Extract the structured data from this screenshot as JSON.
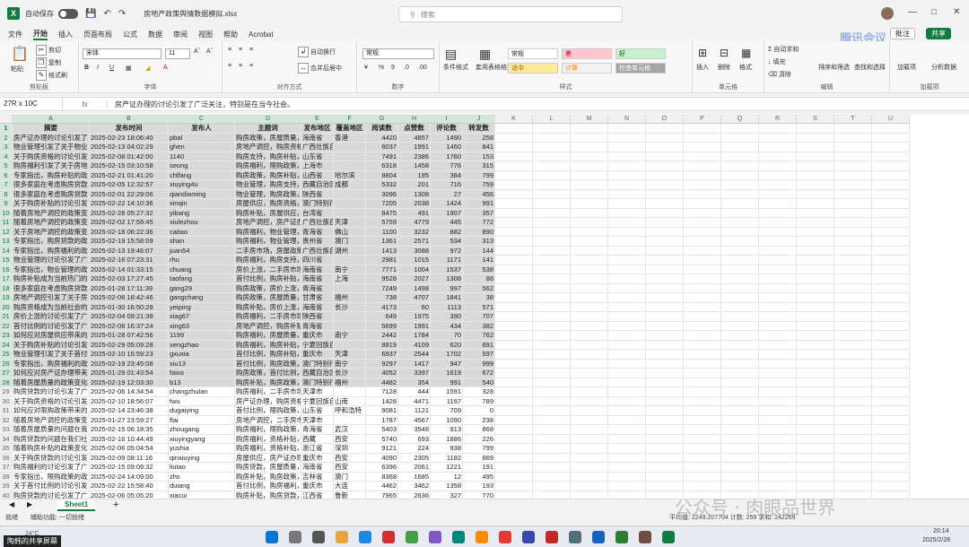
{
  "titlebar": {
    "autosave_label": "自动保存",
    "toggle_state": "关",
    "doc_title": "房地产政策舆情数据模拟.xlsx",
    "search_placeholder": "搜索"
  },
  "menu": {
    "items": [
      "文件",
      "开始",
      "插入",
      "页面布局",
      "公式",
      "数据",
      "审阅",
      "视图",
      "帮助",
      "Acrobat"
    ],
    "active": "开始",
    "comment_label": "批注",
    "share_label": "共享"
  },
  "ribbon": {
    "clipboard_label": "剪贴板",
    "cut": "剪切",
    "copy": "复制",
    "format_painter": "格式刷",
    "paste": "粘贴",
    "font_label": "字体",
    "font_name": "宋体",
    "font_size": "11",
    "align_label": "对齐方式",
    "wrap_text": "自动换行",
    "merge_center": "合并后居中",
    "number_label": "数字",
    "number_format": "常规",
    "styles_label": "样式",
    "cond_format": "条件格式",
    "table_format": "套用表格格式",
    "style_cells": [
      "常规",
      "差",
      "好",
      "适中",
      "计算",
      "检查单元格"
    ],
    "cells_label": "单元格",
    "insert": "插入",
    "delete": "删除",
    "format": "格式",
    "editing_label": "编辑",
    "autosum": "自动求和",
    "fill": "填充",
    "clear": "清除",
    "sort_filter": "排序和筛选",
    "find_select": "查找和选择",
    "addins_label": "加载项",
    "addins": "加载项",
    "analyze": "分析数据"
  },
  "formula_bar": {
    "name_box": "27R x 10C",
    "fx": "fx",
    "formula": "房产证办理的讨论引发了广泛关注，特别是在当今社会。"
  },
  "columns": [
    "A",
    "B",
    "C",
    "D",
    "E",
    "F",
    "G",
    "H",
    "I",
    "J",
    "K",
    "L",
    "M",
    "N",
    "O",
    "P",
    "Q",
    "R",
    "S",
    "T",
    "U"
  ],
  "headers": [
    "摘要",
    "发布时间",
    "发布人",
    "主题词",
    "发布地区",
    "覆盖地区",
    "阅读数",
    "点赞数",
    "评论数",
    "转发数"
  ],
  "rows": [
    [
      "房产证办理的讨论引发了",
      "2025-02-23 18:06:40",
      "pbal",
      "购房政策，房屋质量，",
      "海南省",
      "香港",
      "4420",
      "4857",
      "1490",
      "258"
    ],
    [
      "物业管理引发了关于物业",
      "2025-02-13 04:02:29",
      "ghen",
      "房地产调控，购房资格",
      "广西壮族自治区",
      "",
      "6037",
      "1991",
      "1460",
      "841"
    ],
    [
      "关于购房资格的讨论引发",
      "2025-02-08 01:42:00",
      "1140",
      "购房支持，购房补贴，",
      "山东省",
      "",
      "7491",
      "2386",
      "1760",
      "153"
    ],
    [
      "购房福利引发了关于房地",
      "2025-02-15 03:10:58",
      "seong",
      "购房福利，限购政策，",
      "上海市",
      "",
      "6318",
      "1458",
      "776",
      "315"
    ],
    [
      "专家指出，购房补贴的政",
      "2025-02-21 01:41:20",
      "chlfang",
      "购房政策，购房补贴，",
      "山西省",
      "哈尔滨",
      "8804",
      "195",
      "384",
      "799"
    ],
    [
      "很多家庭在考虑购房贷款",
      "2025-02-05 12:32:57",
      "xiuying4u",
      "物业管理，购房支持，",
      "西藏自治区",
      "成都",
      "5332",
      "201",
      "716",
      "759"
    ],
    [
      "很多家庭在考虑购房贷款",
      "2025-02-01 22:29:06",
      "qiandiaming",
      "物业管理，购房政策，",
      "陕西省",
      "",
      "3096",
      "1308",
      "27",
      "456"
    ],
    [
      "关于购房补贴的讨论引发",
      "2025-02-22 14:10:36",
      "xinqin",
      "房屋供应，购房资格，",
      "澳门特别行政区",
      "",
      "7205",
      "2038",
      "1424",
      "991"
    ],
    [
      "随着房地产调控的政策变",
      "2025-02-28 05:27:32",
      "yibang",
      "购房补贴，房屋供应，",
      "台湾省",
      "",
      "8475",
      "491",
      "1907",
      "357"
    ],
    [
      "随着房地产调控的政策变",
      "2025-02-02 17:59:45",
      "xiulezhou",
      "房地产调控，房产证办",
      "广西壮族自治区",
      "天津",
      "5759",
      "4779",
      "445",
      "772"
    ],
    [
      "关于房地产调控的政策变",
      "2025-02-18 06:22:36",
      "caitao",
      "购房福利，物业管理，",
      "青海省",
      "佛山",
      "1100",
      "3232",
      "882",
      "890"
    ],
    [
      "专家指出，购房贷款的政",
      "2025-02-19 15:58:09",
      "shan",
      "购房福利，物业管理，",
      "贵州省",
      "澳门",
      "1361",
      "2571",
      "534",
      "313"
    ],
    [
      "专家指出，购房福利的政",
      "2025-02-13 19:46:07",
      "juan54",
      "二手房市场，房屋政策，",
      "广西壮族自治区",
      "湖州",
      "1413",
      "3088",
      "972",
      "144"
    ],
    [
      "物业管理的讨论引发了广",
      "2025-02-16 07:23:31",
      "rhu",
      "购房福利，购房支持，",
      "四川省",
      "",
      "2981",
      "1015",
      "1171",
      "141"
    ],
    [
      "专家指出，物业管理的政",
      "2025-02-14 01:33:15",
      "chuang",
      "房价上涨，二手房市场",
      "海南省",
      "南宁",
      "7771",
      "1004",
      "1537",
      "538"
    ],
    [
      "购房补贴成为当前热门的",
      "2025-02-03 17:27:45",
      "taofang",
      "首付比例，购房补贴，",
      "海南省",
      "上海",
      "9528",
      "2027",
      "1308",
      "88"
    ],
    [
      "很多家庭在考虑购房贷款",
      "2025-01-28 17:11:39",
      "gang29",
      "购房政策，房价上涨，",
      "青海省",
      "",
      "7249",
      "1498",
      "997",
      "562"
    ],
    [
      "房地产调控引发了关于房",
      "2025-02-06 18:42:46",
      "gangchang",
      "购房政策，房屋质量，",
      "甘肃省",
      "福州",
      "738",
      "4707",
      "1841",
      "38"
    ],
    [
      "购房资格成为当前社会的",
      "2025-01-30 16:50:28",
      "yeiping",
      "购房补贴，房价上涨，",
      "海南省",
      "长沙",
      "4173",
      "60",
      "1113",
      "571"
    ],
    [
      "房价上涨的讨论引发了广",
      "2025-02-04 09:21:38",
      "xiag67",
      "购房福利，二手房市场，",
      "陕西省",
      "",
      "649",
      "1975",
      "390",
      "707"
    ],
    [
      "首付比例的讨论引发了广",
      "2025-02-06 16:37:24",
      "xing63",
      "房地产调控，购房补贴，",
      "青海省",
      "",
      "5699",
      "1991",
      "434",
      "382"
    ],
    [
      "如何应对房屋供应带来的",
      "2025-01-28 07:42:56",
      "1199",
      "购房福利，房屋质量，",
      "重庆市",
      "南宁",
      "2442",
      "1784",
      "70",
      "762"
    ],
    [
      "关于购房补贴的讨论引发",
      "2025-02-29 05:09:28",
      "xengzhao",
      "购房福利，购房补贴，",
      "宁夏回族自治区",
      "",
      "8819",
      "4109",
      "620",
      "891"
    ],
    [
      "物业管理引发了关于首付",
      "2025-02-10 15:59:23",
      "gxuxia",
      "首付比例，购房补贴，",
      "重庆市",
      "天津",
      "6937",
      "2544",
      "1702",
      "597"
    ],
    [
      "专家指出，购房福利的政",
      "2025-02-19 23:45:08",
      "xiu13",
      "首付比例，购房政策，",
      "澳门特别行政区",
      "南宁",
      "9297",
      "1417",
      "947",
      "999"
    ],
    [
      "如何应对房产证办理带来",
      "2025-01-29 01:43:54",
      "faixo",
      "购房政策，首付比例，",
      "西藏自治区",
      "长沙",
      "4052",
      "3397",
      "1619",
      "672"
    ],
    [
      "随着房屋质量的政策变化",
      "2025-02-19 12:03:30",
      "b13",
      "购房补贴，购房政策，",
      "澳门特别行政区",
      "福州",
      "4482",
      "354",
      "991",
      "540"
    ],
    [
      "购房贷款的讨论引发了广",
      "2025-02-06 14:34:54",
      "changzhulan",
      "购房福利，二手房市场，",
      "天津市",
      "",
      "7128",
      "444",
      "1591",
      "328"
    ],
    [
      "关于购房资格的讨论引发",
      "2025-02-10 18:56:07",
      "fwu",
      "房产证办理，购房资格",
      "宁夏回族自治区",
      "山南",
      "1428",
      "4471",
      "1197",
      "789"
    ],
    [
      "如何应对限购政策带来的",
      "2025-02-14 23:46:38",
      "dugaiying",
      "首付比例，限购政策，",
      "山东省",
      "呼和浩特",
      "9081",
      "1121",
      "709",
      "0"
    ],
    [
      "随着房地产调控的政策变",
      "2025-01-27 23:59:27",
      "flai",
      "房地产调控，二手房市场",
      "天津市",
      "",
      "1787",
      "4567",
      "1090",
      "238"
    ],
    [
      "随着房屋质量的问题在我",
      "2025-02-15 06:18:35",
      "zhougang",
      "购房福利，限购政策，",
      "青海省",
      "武汉",
      "5403",
      "3548",
      "913",
      "868"
    ],
    [
      "购房贷款的问题在我们社",
      "2025-02-16 10:44:49",
      "xiuyingyang",
      "购房福利，资格补贴，",
      "西藏",
      "西安",
      "5740",
      "693",
      "1886",
      "226"
    ],
    [
      "随着购房补贴的政策变化",
      "2025-02-06 05:04:54",
      "yushia",
      "购房福利，资格补贴，",
      "浙江省",
      "深圳",
      "9121",
      "224",
      "938",
      "799"
    ],
    [
      "关于购房贷款的讨论引发",
      "2025-02-09 08:11:16",
      "qinxiuying",
      "房屋供应，房产证办理",
      "重庆市",
      "西安",
      "4090",
      "2305",
      "1182",
      "869"
    ],
    [
      "购房福利的讨论引发了广",
      "2025-02-15 09:09:32",
      "liutao",
      "购房贷款，房屋质量，",
      "海南省",
      "西安",
      "6396",
      "2061",
      "1221",
      "191"
    ],
    [
      "专家指出，限购政策的政",
      "2025-02-24 14:09:00",
      "zhs",
      "购房补贴，购房政策，",
      "吉林省",
      "澳门",
      "8368",
      "1685",
      "12",
      "495"
    ],
    [
      "关于首付比例的讨论引发",
      "2025-02-22 15:58:40",
      "duiang",
      "首付比例，购房福利，",
      "重庆市",
      "大连",
      "4462",
      "3462",
      "1358",
      "193"
    ],
    [
      "购房贷款的讨论引发了广",
      "2025-02-06 05:05:20",
      "xiacui",
      "购房补贴，购房贷款，",
      "江西省",
      "鲁新",
      "7965",
      "2636",
      "327",
      "770"
    ],
    [
      "随着房价上涨的政策变化",
      "2025-01-29 00:51:00",
      "guiyingxia",
      "房屋质量，房屋供应，",
      "青海省",
      "柳州",
      "5744",
      "3924",
      "661",
      "96"
    ]
  ],
  "sheet": {
    "tab": "Sheet1",
    "add": "+"
  },
  "status": {
    "ready": "就绪",
    "accessibility": "辅助功能: 一切就绪",
    "stats": "平均值: 2249.207704    计数: 259    求和: 242269"
  },
  "taskbar": {
    "time": "20:14",
    "date": "2025/2/28",
    "share_label": "陶韩的共享屏幕",
    "weather": "24°C"
  },
  "watermark": "公众号 · 肉眼品世界",
  "overlay_logo": "腾讯会议",
  "colors": {
    "accent": "#107c41",
    "selection": "#d9d9d9",
    "header_bg": "#f0f0f0"
  }
}
